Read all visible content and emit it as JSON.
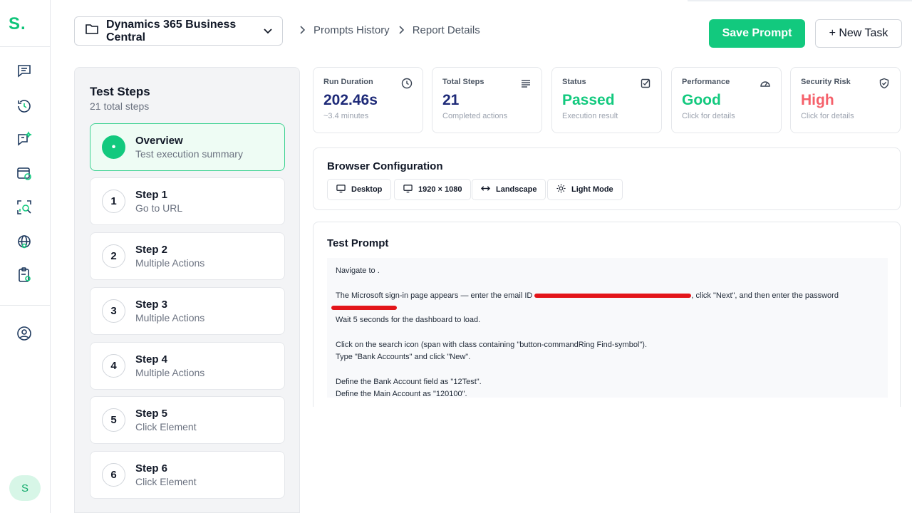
{
  "rail": {
    "logo": "S.",
    "user_initial": "S"
  },
  "header": {
    "project": "Dynamics 365 Business Central",
    "breadcrumb": [
      "Prompts History",
      "Report Details"
    ],
    "save_label": "Save Prompt",
    "new_label": "+ New Task"
  },
  "steps": {
    "title": "Test Steps",
    "subtitle": "21 total steps",
    "items": [
      {
        "num": "•",
        "label": "Overview",
        "desc": "Test execution summary"
      },
      {
        "num": "1",
        "label": "Step 1",
        "desc": "Go to URL"
      },
      {
        "num": "2",
        "label": "Step 2",
        "desc": "Multiple Actions"
      },
      {
        "num": "3",
        "label": "Step 3",
        "desc": "Multiple Actions"
      },
      {
        "num": "4",
        "label": "Step 4",
        "desc": "Multiple Actions"
      },
      {
        "num": "5",
        "label": "Step 5",
        "desc": "Click Element"
      },
      {
        "num": "6",
        "label": "Step 6",
        "desc": "Click Element"
      }
    ]
  },
  "metrics": [
    {
      "label": "Run Duration",
      "value": "202.46s",
      "sub": "~3.4 minutes",
      "color": "#1e2a78",
      "icon": "clock-icon"
    },
    {
      "label": "Total Steps",
      "value": "21",
      "sub": "Completed actions",
      "color": "#1e2a78",
      "icon": "list-icon"
    },
    {
      "label": "Status",
      "value": "Passed",
      "sub": "Execution result",
      "color": "#12c97e",
      "icon": "check-square-icon"
    },
    {
      "label": "Performance",
      "value": "Good",
      "sub": "Click for details",
      "color": "#12c97e",
      "icon": "gauge-icon"
    },
    {
      "label": "Security Risk",
      "value": "High",
      "sub": "Click for details",
      "color": "#f5606a",
      "icon": "shield-check-icon"
    }
  ],
  "browser_config": {
    "title": "Browser Configuration",
    "chips": [
      "Desktop",
      "1920 × 1080",
      "Landscape",
      "Light Mode"
    ]
  },
  "prompt": {
    "title": "Test Prompt",
    "line1": "Navigate to .",
    "line2a": "The Microsoft sign-in page appears — enter the email ID ",
    "line2b": ", click \"Next\", and then enter the password",
    "line3": "Wait 5 seconds for the dashboard to load.",
    "line4": "Click on the search icon (span with class containing \"button-commandRing Find-symbol\").",
    "line5": "Type \"Bank Accounts\" and click \"New\".",
    "line6": "Define the Bank Account field as \"12Test\".",
    "line7": "Define the Main Account as \"120100\"."
  },
  "colors": {
    "accent": "#12c97e",
    "redaction": "#e3151a"
  }
}
